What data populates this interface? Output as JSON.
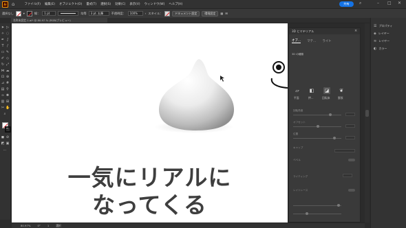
{
  "app": {
    "logo": "Ai",
    "share_label": "共有"
  },
  "menu": [
    "ファイル(F)",
    "編集(E)",
    "オブジェクト(O)",
    "書式(T)",
    "選択(S)",
    "効果(C)",
    "表示(V)",
    "ウィンドウ(W)",
    "ヘルプ(H)"
  ],
  "control_bar": {
    "selection_label": "選択なし",
    "stroke_label": "線：",
    "stroke_weight": "1 pt",
    "brush_label": "均等",
    "brush_size": "3 pt. 丸筆",
    "opacity_label": "不透明度：",
    "opacity_value": "100%",
    "style_label": "スタイル：",
    "doc_setup_label": "ドキュメント設定",
    "prefs_label": "環境設定"
  },
  "document_tab": {
    "title": "名称未設定-1.ai* @ 80.97 % (RGB/プレビュー)"
  },
  "canvas": {
    "caption_line1": "一気にリアルに",
    "caption_line2": "なってくる"
  },
  "status_bar": {
    "zoom": "80.97%",
    "angle": "0°",
    "artboard": "1",
    "tool": "選択"
  },
  "panel_3d": {
    "title": "3D とマテリアル",
    "tabs": [
      "オブ…",
      "マテ…",
      "ライト"
    ],
    "section_3d_type": "3D の種類",
    "types": [
      "平面",
      "押…",
      "回転体",
      "膨張"
    ],
    "props": [
      "回転角度",
      "オフセット",
      "位置",
      "キャップ",
      "ベベル",
      "ライティング",
      "レイトレース"
    ]
  },
  "side_panels": [
    "プロパティ",
    "レイヤー",
    "レイヤー",
    "カラー"
  ],
  "colors": {
    "accent": "#1473e6",
    "canvas": "#ffffff",
    "caption": "#3e3e3e",
    "logo": "#ff9a00"
  }
}
